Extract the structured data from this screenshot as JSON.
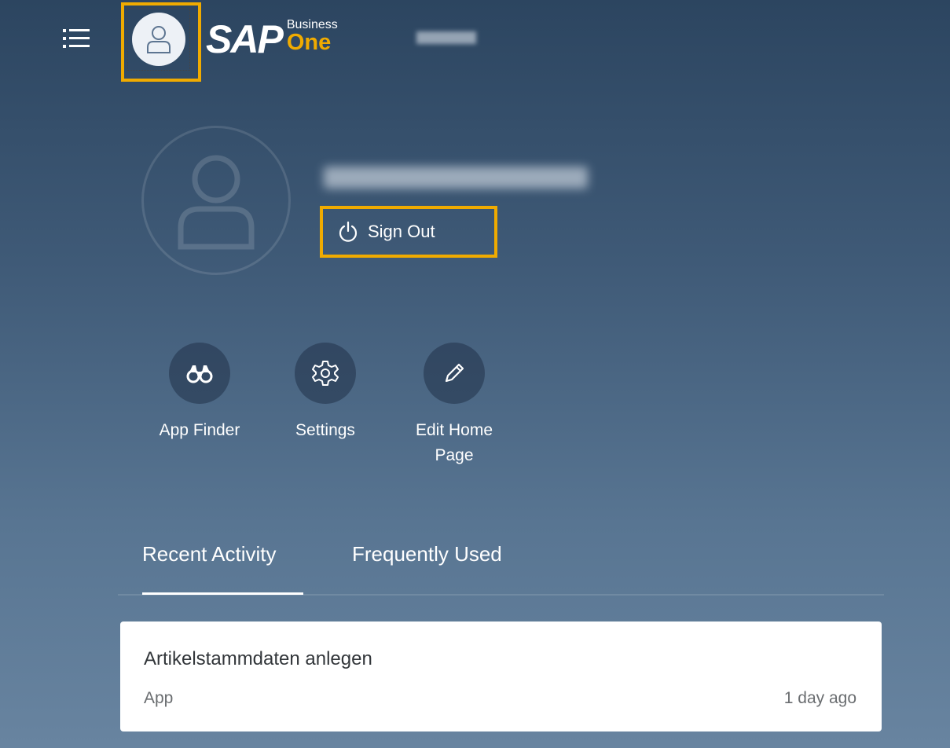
{
  "header": {
    "menu_icon": "list-icon",
    "user_icon": "person-icon",
    "logo": {
      "sap": "SAP",
      "business": "Business",
      "one": "One"
    },
    "company_name": "redacted"
  },
  "profile": {
    "avatar_icon": "person-icon",
    "user_name": "redacted",
    "sign_out_label": "Sign Out",
    "sign_out_icon": "power-icon"
  },
  "actions": [
    {
      "label": "App Finder",
      "icon": "binoculars-icon"
    },
    {
      "label": "Settings",
      "icon": "gear-icon"
    },
    {
      "label": "Edit Home Page",
      "icon": "pencil-icon"
    }
  ],
  "tabs": [
    {
      "label": "Recent Activity",
      "selected": true
    },
    {
      "label": "Frequently Used",
      "selected": false
    }
  ],
  "recent_items": [
    {
      "title": "Artikelstammdaten anlegen",
      "type": "App",
      "time": "1 day ago"
    }
  ],
  "colors": {
    "highlight": "#f0ab00",
    "background_top": "#2c4560",
    "background_bottom": "#6884a0",
    "logo_accent": "#f0ab00"
  }
}
